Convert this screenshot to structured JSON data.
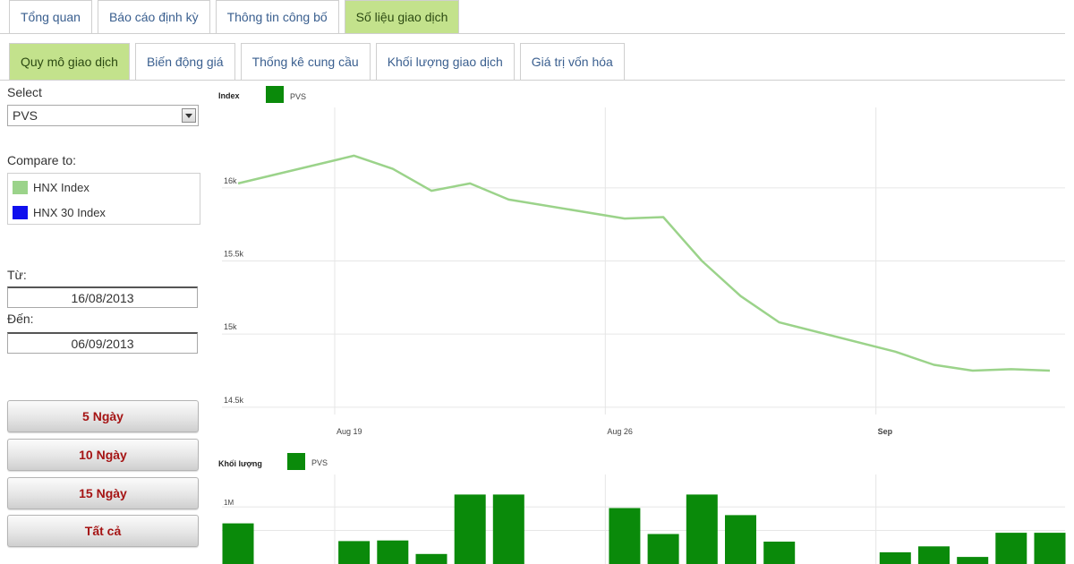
{
  "top_tabs": [
    {
      "label": "Tổng quan"
    },
    {
      "label": "Báo cáo định kỳ"
    },
    {
      "label": "Thông tin công bố"
    },
    {
      "label": "Số liệu giao dịch"
    }
  ],
  "sub_tabs": [
    {
      "label": "Quy mô giao dịch"
    },
    {
      "label": "Biến động giá"
    },
    {
      "label": "Thống kê cung cầu"
    },
    {
      "label": "Khối lượng giao dịch"
    },
    {
      "label": "Giá trị vốn hóa"
    }
  ],
  "sidebar": {
    "select_label": "Select",
    "select_value": "PVS",
    "compare_label": "Compare to:",
    "compare_items": [
      {
        "label": "HNX Index",
        "color": "#9bd38a"
      },
      {
        "label": "HNX 30 Index",
        "color": "#1010ee"
      }
    ],
    "from_label": "Từ:",
    "from_value": "16/08/2013",
    "to_label": "Đến:",
    "to_value": "06/09/2013",
    "range_buttons": [
      {
        "label": "5 Ngày"
      },
      {
        "label": "10 Ngày"
      },
      {
        "label": "15 Ngày"
      },
      {
        "label": "Tất cả"
      }
    ]
  },
  "colors": {
    "active_tab": "#c3e28c",
    "line": "#9bd38a",
    "bar": "#0a8a0a",
    "button_text": "#a51414"
  },
  "chart_data": [
    {
      "type": "line",
      "ylabel": "Index",
      "legend": "PVS",
      "yticks": [
        {
          "value": 14500,
          "label": "14.5k"
        },
        {
          "value": 15000,
          "label": "15k"
        },
        {
          "value": 15500,
          "label": "15.5k"
        },
        {
          "value": 16000,
          "label": "16k"
        }
      ],
      "xticks": [
        {
          "value": 3,
          "label": "Aug 19"
        },
        {
          "value": 10,
          "label": "Aug 26"
        },
        {
          "value": 17,
          "label": "Sep"
        }
      ],
      "xlim": [
        0.5,
        21.8
      ],
      "ylim": [
        14450,
        16550
      ],
      "x": [
        0.5,
        3.5,
        4.5,
        5.5,
        6.5,
        7.5,
        10.5,
        11.5,
        12.5,
        13.5,
        14.5,
        17.5,
        18.5,
        19.5,
        20.5,
        21.5
      ],
      "y": [
        16030,
        16220,
        16130,
        15980,
        16030,
        15920,
        15790,
        15800,
        15500,
        15260,
        15080,
        14880,
        14790,
        14750,
        14760,
        14750
      ]
    },
    {
      "type": "bar",
      "ylabel": "Khối lượng",
      "legend": "PVS",
      "yticks": [
        {
          "value": 1000000,
          "label": "1M"
        }
      ],
      "xlim": [
        0.5,
        21.8
      ],
      "ylim": [
        0,
        1550000
      ],
      "x": [
        0.5,
        3.5,
        4.5,
        5.5,
        6.5,
        7.5,
        10.5,
        11.5,
        12.5,
        13.5,
        14.5,
        17.5,
        18.5,
        19.5,
        20.5,
        21.5
      ],
      "values": [
        720000,
        420000,
        430000,
        200000,
        1210000,
        1210000,
        980000,
        540000,
        1210000,
        860000,
        410000,
        230000,
        330000,
        150000,
        560000,
        560000
      ]
    }
  ]
}
